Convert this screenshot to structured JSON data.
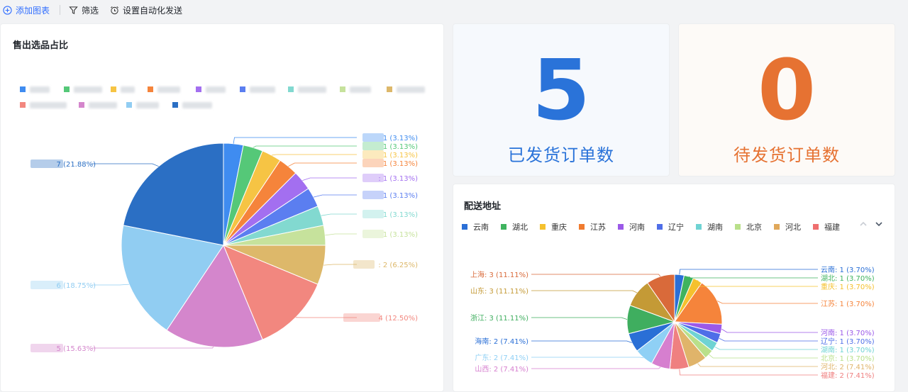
{
  "toolbar": {
    "add_chart": "添加图表",
    "filter": "筛选",
    "auto_send": "设置自动化发送"
  },
  "product_card": {
    "title": "售出选品占比",
    "chart_data": {
      "type": "pie",
      "title": "售出选品占比",
      "slices": [
        {
          "value": 7,
          "percent": "21.88%",
          "color": "#2b6fc4",
          "label_suffix": "7 (21.88%)"
        },
        {
          "value": 6,
          "percent": "18.75%",
          "color": "#91cdf2",
          "label_suffix": "6 (18.75%)"
        },
        {
          "value": 5,
          "percent": "15.63%",
          "color": "#d486cc",
          "label_suffix": "5 (15.63%)"
        },
        {
          "value": 4,
          "percent": "12.50%",
          "color": "#f2877f",
          "label_suffix": "4 (12.50%)"
        },
        {
          "value": 2,
          "percent": "6.25%",
          "color": "#ddb86a",
          "label_suffix": ": 2 (6.25%)"
        },
        {
          "value": 1,
          "percent": "3.13%",
          "color": "#c6e29c",
          "label_suffix": "1 (3.13%)"
        },
        {
          "value": 1,
          "percent": "3.13%",
          "color": "#82d9d0",
          "label_suffix": "1 (3.13%)"
        },
        {
          "value": 1,
          "percent": "3.13%",
          "color": "#5b7ef0",
          "label_suffix": "1 (3.13%)"
        },
        {
          "value": 1,
          "percent": "3.13%",
          "color": "#a36ff0",
          "label_suffix": ": 1 (3.13%)"
        },
        {
          "value": 1,
          "percent": "3.13%",
          "color": "#f5843b",
          "label_suffix": "1 (3.13%)"
        },
        {
          "value": 1,
          "percent": "3.13%",
          "color": "#f6c444",
          "label_suffix": "1 (3.13%)"
        },
        {
          "value": 1,
          "percent": "3.13%",
          "color": "#55c878",
          "label_suffix": "1 (3.13%)"
        },
        {
          "value": 1,
          "percent": "3.13%",
          "color": "#3f8cf0",
          "label_suffix": "1 (3.13%)"
        }
      ],
      "legend_colors": [
        "#3f8cf0",
        "#55c878",
        "#f6c444",
        "#f5843b",
        "#a36ff0",
        "#5b7ef0",
        "#82d9d0",
        "#c6e29c",
        "#ddb86a",
        "#f2877f",
        "#d486cc",
        "#91cdf2",
        "#2b6fc4"
      ]
    }
  },
  "shipped_card": {
    "value": "5",
    "label": "已发货订单数",
    "color": "#2a73d9"
  },
  "pending_card": {
    "value": "0",
    "label": "待发货订单数",
    "color": "#e67232"
  },
  "address_card": {
    "title": "配送地址",
    "legend": [
      {
        "name": "云南",
        "color": "#2a6fd6"
      },
      {
        "name": "湖北",
        "color": "#3fb35f"
      },
      {
        "name": "重庆",
        "color": "#f5c12e"
      },
      {
        "name": "江苏",
        "color": "#f07b2f"
      },
      {
        "name": "河南",
        "color": "#9b59e8"
      },
      {
        "name": "辽宁",
        "color": "#4f6ee8"
      },
      {
        "name": "湖南",
        "color": "#6fd3d3"
      },
      {
        "name": "北京",
        "color": "#b9e08a"
      },
      {
        "name": "河北",
        "color": "#e0a85a"
      },
      {
        "name": "福建",
        "color": "#ef6f6f"
      }
    ],
    "chart_data": {
      "type": "pie",
      "title": "配送地址",
      "slices": [
        {
          "name": "云南",
          "value": 1,
          "percent": "3.70%",
          "color": "#2a6fd6",
          "label": "云南: 1 (3.70%)"
        },
        {
          "name": "湖北",
          "value": 1,
          "percent": "3.70%",
          "color": "#3fb35f",
          "label": "湖北: 1 (3.70%)"
        },
        {
          "name": "重庆",
          "value": 1,
          "percent": "3.70%",
          "color": "#f5c12e",
          "label": "重庆: 1 (3.70%)"
        },
        {
          "name": "江苏",
          "value": 5,
          "percent": "18.52%",
          "color": "#f5843b",
          "label": "江苏: 1 (3.70%)"
        },
        {
          "name": "河南",
          "value": 1,
          "percent": "3.70%",
          "color": "#9b59e8",
          "label": "河南: 1 (3.70%)"
        },
        {
          "name": "辽宁",
          "value": 1,
          "percent": "3.70%",
          "color": "#4f6ee8",
          "label": "辽宁: 1 (3.70%)"
        },
        {
          "name": "湖南",
          "value": 1,
          "percent": "3.70%",
          "color": "#6fd3d3",
          "label": "湖南: 1 (3.70%)"
        },
        {
          "name": "北京",
          "value": 1,
          "percent": "3.70%",
          "color": "#b9e08a",
          "label": "北京: 1 (3.70%)"
        },
        {
          "name": "河北",
          "value": 2,
          "percent": "7.41%",
          "color": "#e0b46a",
          "label": "河北: 2 (7.41%)"
        },
        {
          "name": "福建",
          "value": 2,
          "percent": "7.41%",
          "color": "#ef8080",
          "label": "福建: 2 (7.41%)"
        },
        {
          "name": "山西",
          "value": 2,
          "percent": "7.41%",
          "color": "#d67fcf",
          "label": "山西: 2 (7.41%)"
        },
        {
          "name": "广东",
          "value": 2,
          "percent": "7.41%",
          "color": "#8fd0f5",
          "label": "广东: 2 (7.41%)"
        },
        {
          "name": "海南",
          "value": 2,
          "percent": "7.41%",
          "color": "#2a6fd6",
          "label": "海南: 2 (7.41%)"
        },
        {
          "name": "浙江",
          "value": 3,
          "percent": "11.11%",
          "color": "#3fae5f",
          "label": "浙江: 3 (11.11%)"
        },
        {
          "name": "山东",
          "value": 3,
          "percent": "11.11%",
          "color": "#c49a36",
          "label": "山东: 3 (11.11%)"
        },
        {
          "name": "上海",
          "value": 3,
          "percent": "11.11%",
          "color": "#d96a3a",
          "label": "上海: 3 (11.11%)"
        }
      ]
    }
  }
}
